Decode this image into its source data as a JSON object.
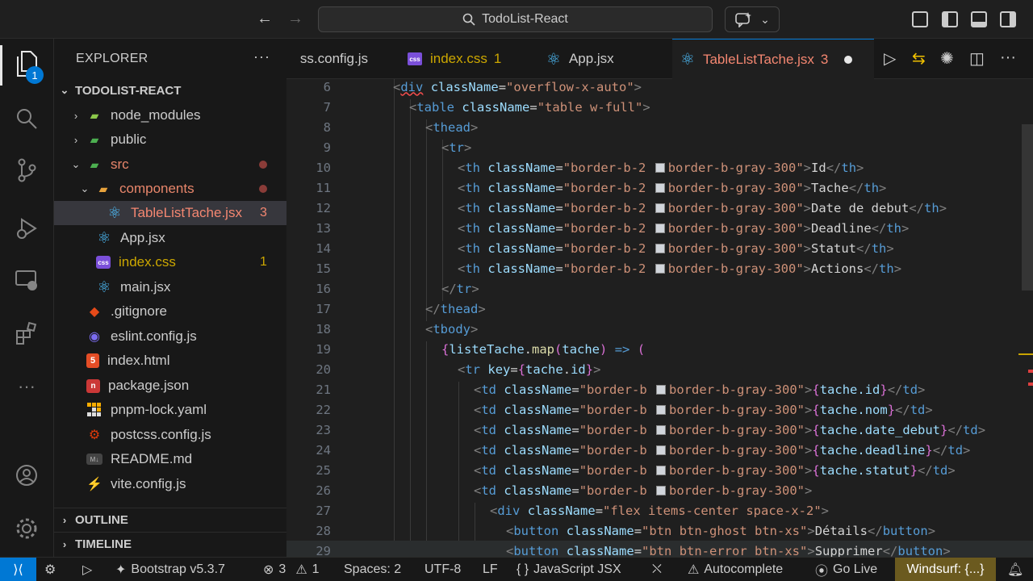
{
  "titlebar": {
    "search_text": "TodoList-React"
  },
  "sidebar": {
    "title": "EXPLORER",
    "more": "···",
    "project": "TODOLIST-REACT",
    "items": [
      {
        "label": "node_modules",
        "type": "folder",
        "icon": "node-folder-icon"
      },
      {
        "label": "public",
        "type": "folder",
        "icon": "public-folder-icon"
      },
      {
        "label": "src",
        "type": "folder",
        "icon": "src-folder-icon",
        "color": "#e8866b"
      },
      {
        "label": "components",
        "type": "folder",
        "icon": "folder-icon",
        "color": "#e8866b"
      },
      {
        "label": "TableListTache.jsx",
        "type": "file",
        "icon": "react-icon",
        "count": "3",
        "color": "#f48771"
      },
      {
        "label": "App.jsx",
        "type": "file",
        "icon": "react-icon"
      },
      {
        "label": "index.css",
        "type": "file",
        "icon": "css-icon",
        "count": "1",
        "color": "#cca700"
      },
      {
        "label": "main.jsx",
        "type": "file",
        "icon": "react-icon"
      },
      {
        "label": ".gitignore",
        "type": "file",
        "icon": "git-icon"
      },
      {
        "label": "eslint.config.js",
        "type": "file",
        "icon": "eslint-icon"
      },
      {
        "label": "index.html",
        "type": "file",
        "icon": "html-icon"
      },
      {
        "label": "package.json",
        "type": "file",
        "icon": "npm-icon"
      },
      {
        "label": "pnpm-lock.yaml",
        "type": "file",
        "icon": "pnpm-icon"
      },
      {
        "label": "postcss.config.js",
        "type": "file",
        "icon": "postcss-icon"
      },
      {
        "label": "README.md",
        "type": "file",
        "icon": "markdown-icon"
      },
      {
        "label": "vite.config.js",
        "type": "file",
        "icon": "vite-icon"
      }
    ],
    "outline": "OUTLINE",
    "timeline": "TIMELINE"
  },
  "activity": {
    "badge": "1"
  },
  "tabs": [
    {
      "label": "ss.config.js"
    },
    {
      "label": "index.css",
      "count": "1"
    },
    {
      "label": "App.jsx"
    },
    {
      "label": "TableListTache.jsx",
      "count": "3"
    }
  ],
  "editor": {
    "line_numbers": [
      "6",
      "7",
      "8",
      "9",
      "10",
      "11",
      "12",
      "13",
      "14",
      "15",
      "16",
      "17",
      "18",
      "19",
      "20",
      "21",
      "22",
      "23",
      "24",
      "25",
      "26",
      "27",
      "28",
      "29"
    ],
    "th_headers": [
      "Id",
      "Tache",
      "Date de debut",
      "Deadline",
      "Statut",
      "Actions"
    ],
    "td_fields": [
      "tache.id",
      "tache.nom",
      "tache.date_debut",
      "tache.deadline",
      "tache.statut"
    ],
    "buttons": [
      "Détails",
      "Supprimer"
    ]
  },
  "statusbar": {
    "bootstrap": "Bootstrap v5.3.7",
    "errors": "3",
    "warnings": "1",
    "spaces": "Spaces: 2",
    "encoding": "UTF-8",
    "eol": "LF",
    "language": "JavaScript JSX",
    "autocomplete": "Autocomplete",
    "golive": "Go Live",
    "windsurf": "Windsurf: {...}"
  }
}
